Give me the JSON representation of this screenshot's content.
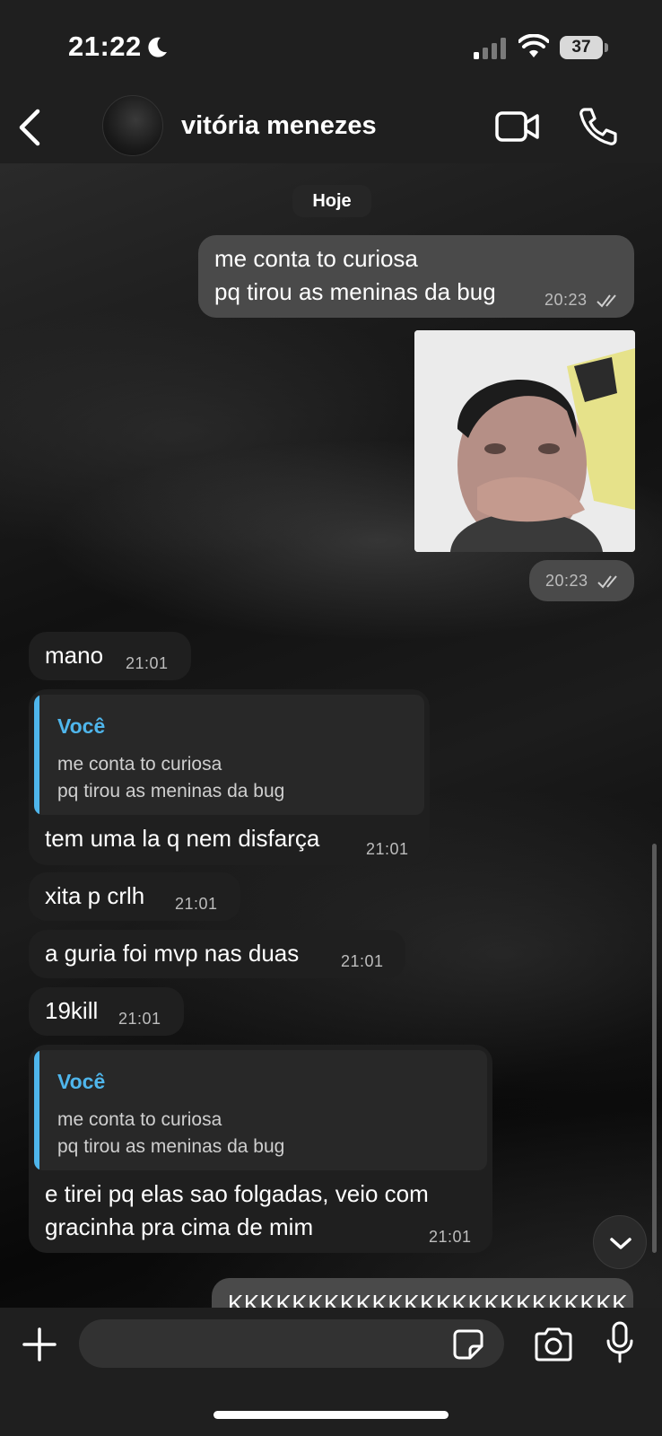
{
  "status_bar": {
    "time": "21:22",
    "battery": "37"
  },
  "header": {
    "contact_name": "vitória menezes"
  },
  "chat": {
    "date_label": "Hoje",
    "messages": [
      {
        "direction": "out",
        "lines": [
          "me conta to curiosa",
          "pq tirou as meninas da bug"
        ],
        "time": "20:23"
      },
      {
        "direction": "out",
        "type": "video",
        "time": "20:23"
      },
      {
        "direction": "in",
        "text": "mano",
        "time": "21:01"
      },
      {
        "direction": "in",
        "quote": {
          "author": "Você",
          "lines": [
            "me conta to curiosa",
            "pq tirou as meninas da bug"
          ]
        },
        "text": "tem uma la q nem disfarça",
        "time": "21:01"
      },
      {
        "direction": "in",
        "text": "xita p crlh",
        "time": "21:01"
      },
      {
        "direction": "in",
        "text": "a guria foi mvp nas duas",
        "time": "21:01"
      },
      {
        "direction": "in",
        "text": "19kill",
        "time": "21:01"
      },
      {
        "direction": "in",
        "quote": {
          "author": "Você",
          "lines": [
            "me conta to curiosa",
            "pq tirou as meninas da bug"
          ]
        },
        "lines": [
          "e tirei pq elas sao folgadas, veio com",
          "gracinha pra cima de mim"
        ],
        "time": "21:01"
      },
      {
        "direction": "out",
        "text": "KKKKKKKKKKKKKKKKKKKKKKKKK"
      }
    ]
  },
  "composer": {
    "placeholder": ""
  },
  "colors": {
    "header_bg": "#1f1f1f",
    "outgoing_bubble": "#4a4a4a",
    "incoming_bubble": "#1f1f1f",
    "quote_accent": "#4fb6ec"
  },
  "icons": [
    "back-icon",
    "video-call-icon",
    "phone-icon",
    "plus-icon",
    "sticker-icon",
    "camera-icon",
    "microphone-icon",
    "chevron-down-icon"
  ]
}
